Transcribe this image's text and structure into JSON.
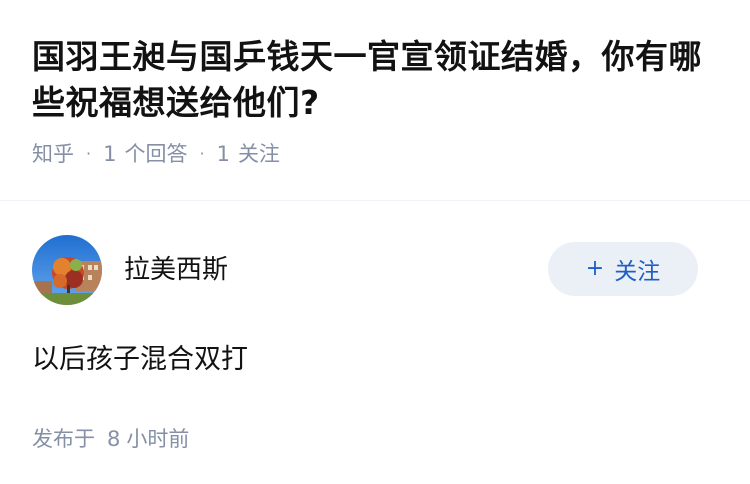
{
  "question": {
    "title": "国羽王昶与国乒钱天一官宣领证结婚，你有哪些祝福想送给他们?",
    "source": "知乎",
    "separator": "·",
    "answer_count": "1",
    "answer_label": "个回答",
    "follow_count": "1",
    "follow_label": "关注"
  },
  "answer": {
    "author_name": "拉美西斯",
    "follow_button": {
      "plus": "+",
      "label": "关注"
    },
    "content": "以后孩子混合双打",
    "published_prefix": "发布于",
    "published_num": "8",
    "published_suffix": "小时前"
  },
  "colors": {
    "primary_text": "#121212",
    "meta_text": "#8590a6",
    "follow_bg": "#ebf0f7",
    "follow_text": "#1f5fc4"
  }
}
